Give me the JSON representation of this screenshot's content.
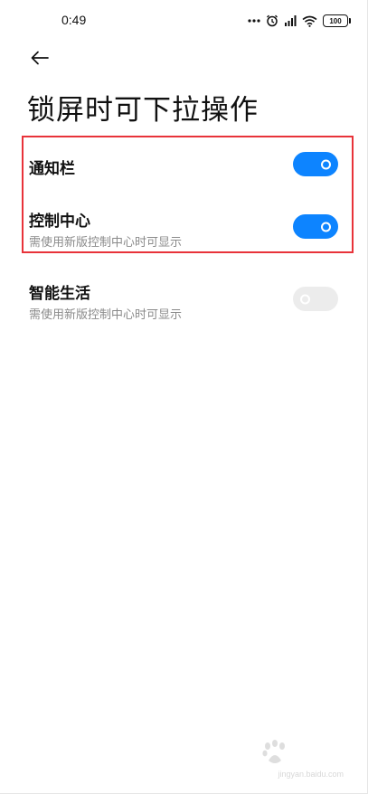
{
  "status_bar": {
    "time": "0:49",
    "battery": "100",
    "icons": [
      "more-dots-icon",
      "alarm-icon",
      "signal-icon",
      "wifi-icon",
      "battery-icon"
    ]
  },
  "header": {
    "title": "锁屏时可下拉操作"
  },
  "settings": [
    {
      "label": "通知栏",
      "sub": "",
      "enabled": true
    },
    {
      "label": "控制中心",
      "sub": "需使用新版控制中心时可显示",
      "enabled": true
    },
    {
      "label": "智能生活",
      "sub": "需使用新版控制中心时可显示",
      "enabled": false
    }
  ],
  "colors": {
    "toggle_on": "#0d84ff",
    "toggle_off": "#ececec",
    "highlight": "#e8333a"
  },
  "watermark": {
    "text": "jingyan.baidu.com"
  }
}
